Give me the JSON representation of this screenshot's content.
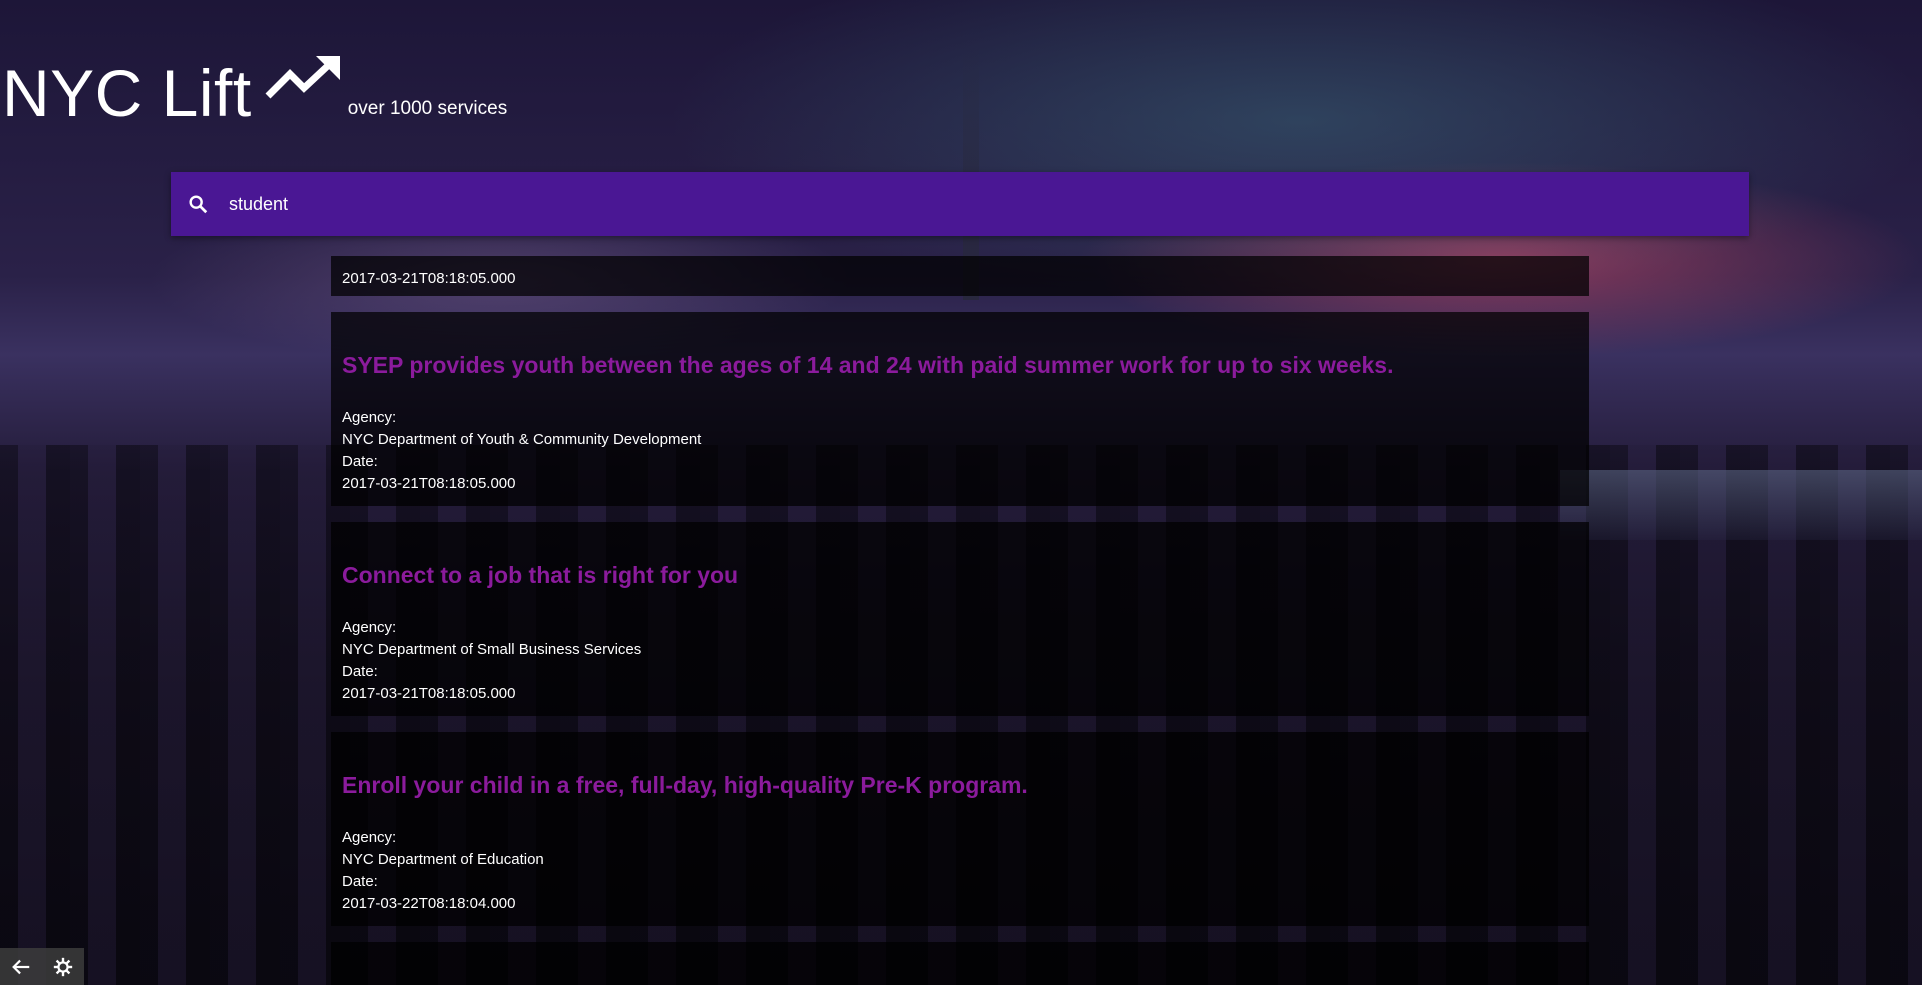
{
  "app": {
    "title": "NYC Lift",
    "tagline": "over 1000 services"
  },
  "search": {
    "value": "student"
  },
  "labels": {
    "agency": "Agency:",
    "date": "Date:"
  },
  "results": [
    {
      "title": "",
      "agency": "",
      "date": "2017-03-21T08:18:05.000",
      "partial": true
    },
    {
      "title": "SYEP provides youth between the ages of 14 and 24 with paid summer work for up to six weeks.",
      "agency": "NYC Department of Youth & Community Development",
      "date": "2017-03-21T08:18:05.000"
    },
    {
      "title": "Connect to a job that is right for you",
      "agency": "NYC Department of Small Business Services",
      "date": "2017-03-21T08:18:05.000"
    },
    {
      "title": "Enroll your child in a free, full-day, high-quality Pre-K program.",
      "agency": "NYC Department of Education",
      "date": "2017-03-22T08:18:04.000"
    }
  ],
  "colors": {
    "search_bar": "#4a1794",
    "result_title": "#8b1b9c"
  },
  "icons": {
    "logo_icon": "trending-up-icon",
    "search": "search-icon",
    "back": "arrow-back-icon",
    "settings": "gear-icon"
  }
}
